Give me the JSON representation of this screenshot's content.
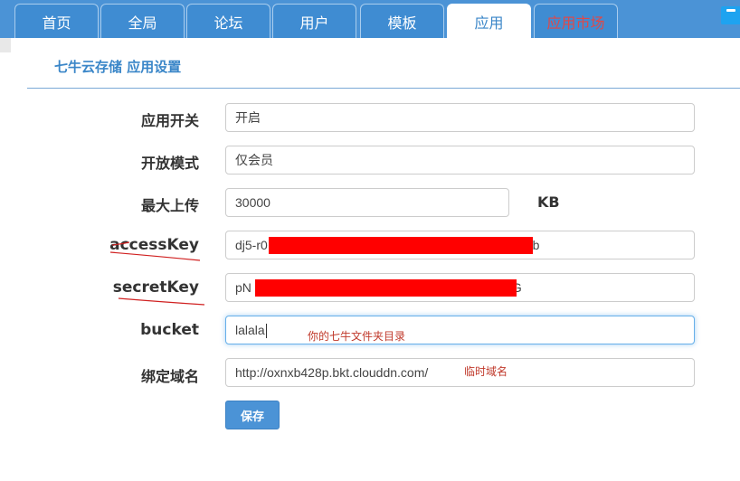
{
  "tabs": [
    {
      "label": "首页",
      "active": false
    },
    {
      "label": "全局",
      "active": false
    },
    {
      "label": "论坛",
      "active": false
    },
    {
      "label": "用户",
      "active": false
    },
    {
      "label": "模板",
      "active": false
    },
    {
      "label": "应用",
      "active": true
    },
    {
      "label": "应用市场",
      "active": false
    }
  ],
  "page_title": "七牛云存储 应用设置",
  "form": {
    "switch": {
      "label": "应用开关",
      "value": "开启"
    },
    "open_mode": {
      "label": "开放模式",
      "value": "仅会员"
    },
    "max_upload": {
      "label": "最大上传",
      "value": "30000",
      "unit": "KB"
    },
    "access_key": {
      "label": "accessKey",
      "value_prefix": "dj5-r0",
      "value_suffix": "8b"
    },
    "secret_key": {
      "label": "secretKey",
      "value_prefix": "pN",
      "value_suffix": "G"
    },
    "bucket": {
      "label": "bucket",
      "value": "lalala",
      "note": "你的七牛文件夹目录"
    },
    "domain": {
      "label": "绑定域名",
      "value": "http://oxnxb428p.bkt.clouddn.com/",
      "note": "临时域名"
    }
  },
  "save_label": "保存",
  "colors": {
    "tabbar": "#4b93d6",
    "accent": "#3a86c8",
    "redaction": "#ff0000",
    "note": "#c0392b"
  }
}
